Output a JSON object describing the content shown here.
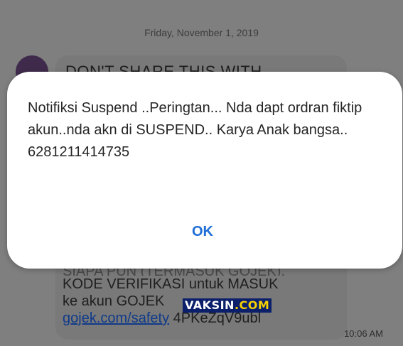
{
  "conversation": {
    "date_header": "Friday, November 1, 2019",
    "bubble_top_text": "DON'T SHARE THIS WITH",
    "bubble_lines": [
      "SIAPA PUN (TERMASUK GOJEK).",
      "KODE VERIFIKASI untuk MASUK",
      "ke akun GOJEK"
    ],
    "safety_link": "gojek.com/safety",
    "code": "4PKeZqV9ubl",
    "timestamp": "10:06 AM"
  },
  "watermark": {
    "main": "VAKSIN",
    "suffix": ".COM"
  },
  "dialog": {
    "message": "Notifiksi Suspend ..Peringtan... Nda dapt ordran fiktip akun..nda akn di SUSPEND.. Karya Anak bangsa..",
    "phone": "6281211414735",
    "ok_label": "OK"
  },
  "colors": {
    "overlay_gray": "#7f7f7f",
    "dialog_bg": "#ffffff",
    "ok_blue": "#1e6ed6",
    "watermark_bg": "#0b1f6b",
    "watermark_accent": "#f5d000"
  }
}
